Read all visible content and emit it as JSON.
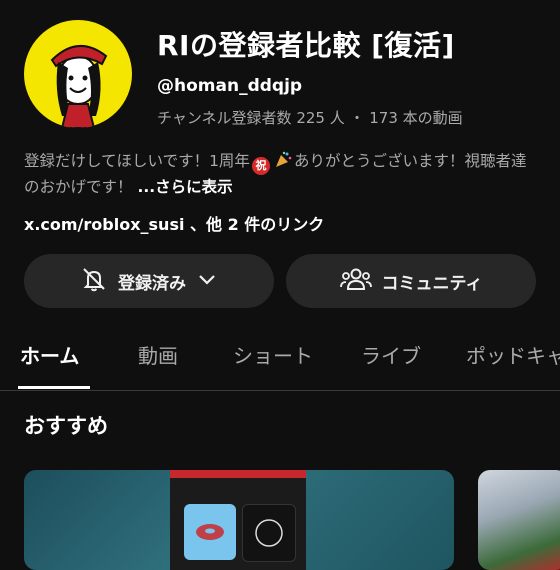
{
  "channel": {
    "title": "RIの登録者比較 [復活]",
    "handle": "@homan_ddqjp",
    "stats": "チャンネル登録者数 225 人 ・ 173 本の動画",
    "description_part1": "登録だけしてほしいです！1周年",
    "description_emoji1": "祝",
    "description_part2": "ありがとうございます！視聴者達のおかげです！",
    "description_more": "...さらに表示",
    "link": "x.com/roblox_susi 、他 2 件のリンク"
  },
  "buttons": {
    "subscribed_label": "登録済み",
    "community_label": "コミュニティ"
  },
  "tabs": [
    {
      "label": "ホーム",
      "active": true
    },
    {
      "label": "動画"
    },
    {
      "label": "ショート"
    },
    {
      "label": "ライブ"
    },
    {
      "label": "ポッドキャ"
    }
  ],
  "section": {
    "title": "おすすめ"
  },
  "colors": {
    "background": "#0f0f0f",
    "avatar_bg": "#f4e600",
    "button_bg": "#272727"
  }
}
